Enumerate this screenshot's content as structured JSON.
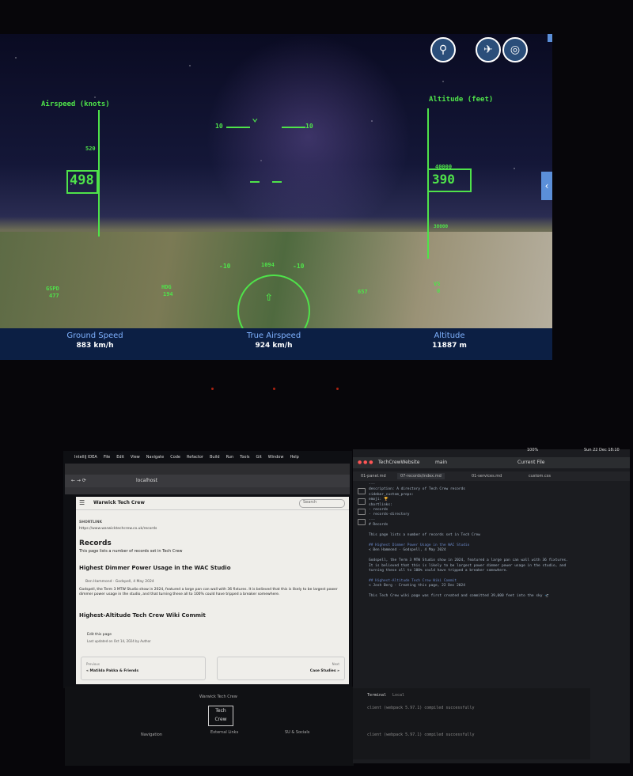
{
  "hud": {
    "airspeed_label": "Airspeed (knots)",
    "altitude_label": "Altitude (feet)",
    "airspeed_value": "498",
    "airspeed_tick": "520",
    "altitude_value": "390",
    "altitude_tick_top": "40000",
    "altitude_tick_bottom": "38000",
    "pitch_left_top": "10",
    "pitch_right_top": "10",
    "pitch_left_bottom": "-10",
    "pitch_right_bottom": "-10",
    "heading_readout": "1094",
    "gspd_label": "GSPD",
    "gspd_value": "477",
    "hdg_label": "HDG",
    "hdg_value": "194",
    "vs_label": "VS",
    "vs_value": "0",
    "side_value": "657"
  },
  "bottom_bar": {
    "ground_speed_label": "Ground Speed",
    "ground_speed_value": "883 km/h",
    "true_airspeed_label": "True Airspeed",
    "true_airspeed_value": "924 km/h",
    "altitude_label": "Altitude",
    "altitude_value": "11887 m"
  },
  "icons": {
    "search": "search-icon",
    "plane": "plane-icon",
    "globe": "globe-icon",
    "close": "close-icon",
    "collapse": "chevron-left-icon"
  },
  "left_monitor": {
    "menubar": [
      "IntelliJ IDEA",
      "File",
      "Edit",
      "View",
      "Navigate",
      "Code",
      "Refactor",
      "Build",
      "Run",
      "Tools",
      "Git",
      "Window",
      "Help"
    ],
    "address": "localhost",
    "site_name": "Warwick Tech Crew",
    "search_label": "Search",
    "shortlink_label": "SHORTLINK",
    "shortlink_url": "https://www.warwicktechcrew.co.uk/records",
    "page_title": "Records",
    "intro": "This page lists a number of records set in Tech Crew",
    "section1_title": "Highest Dimmer Power Usage in the WAC Studio",
    "section1_meta": "Ben Hammond · Godspell, 4 May 2024",
    "section1_body": "Godspell, the Term 3 MTW Studio show in 2024, featured a large pan can wall with 36 fixtures. It is believed that this is likely to be largest power dimmer power usage in the studio, and that turning these all to 100% could have tripped a breaker somewhere.",
    "section2_title": "Highest-Altitude Tech Crew Wiki Commit",
    "edit_link": "Edit this page",
    "updated": "Last updated on Oct 14, 2024 by Author",
    "prev_label": "Previous",
    "prev_link": "« Matilda Pakka & Friends",
    "next_label": "Next",
    "next_link": "Case Studies »",
    "footer_name": "Warwick Tech Crew",
    "footer_logo_top": "Tech",
    "footer_logo_bottom": "Crew",
    "footer_col1": "Navigation",
    "footer_col2": "External Links",
    "footer_col3": "SU & Socials"
  },
  "right_monitor": {
    "clock": "Sun 22 Dec 18:10",
    "battery": "100%",
    "project": "TechCrewWebsite",
    "branch": "main",
    "current_file": "Current File",
    "tabs": [
      "01-panel.md",
      "07-records/index.md",
      "01-services.md",
      "custom.css"
    ],
    "code_lines": [
      "---",
      "description: A directory of Tech Crew records",
      "sidebar_custom_props:",
      "  emoji: 🏆",
      "shortlinks:",
      "  - records",
      "  - records-directory",
      "---",
      "# Records",
      "",
      "This page lists a number of records set in Tech Crew",
      "",
      "## Highest Dimmer Power Usage in the WAC Studio",
      "< Ben Hammond · Godspell, 4 May 2024",
      "",
      "Godspell, the Term 3 MTW Studio show in 2024, featured a large pan can wall with 36 fixtures.",
      "It is believed that this is likely to be largest power dimmer power usage in the studio, and",
      "turning these all to 100% could have tripped a breaker somewhere.",
      "",
      "## Highest-Altitude Tech Crew Wiki Commit",
      "< Josh Berg · Creating this page, 22 Dec 2024",
      "",
      "This Tech Crew wiki page was first created and committed 39,000 feet into the sky 🛫"
    ],
    "terminal_tabs": [
      "Terminal",
      "Local"
    ],
    "terminal_lines": [
      "client (webpack 5.97.1) compiled successfully",
      "client (webpack 5.97.1) compiled successfully"
    ]
  }
}
